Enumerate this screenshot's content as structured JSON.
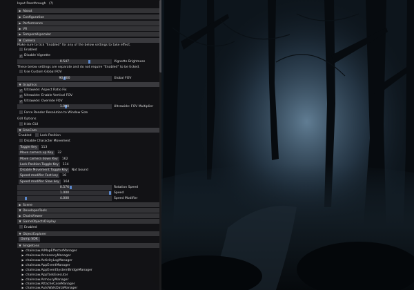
{
  "rows": {
    "input_passthrough": "Input Passthrough",
    "input_passthrough_hint": "(?)",
    "about": "About",
    "configuration": "Configuration",
    "performance": "Performance",
    "vr": "VR",
    "temporal_upscaler": "TemporalUpscaler",
    "camera": "Camera",
    "camera_note": "Make sure to tick \"Enabled\" for any of the below settings to take effect.",
    "enabled": "Enabled",
    "disable_vignette": "Disable Vignette",
    "vignette_value": "0.547",
    "vignette_label": "Vignette Brightness",
    "separate_note": "These below settings are separate and do not require \"Enabled\" to be ticked.",
    "use_custom_fov": "Use Custom Global FOV",
    "global_fov_value": "90.000",
    "global_fov_label": "Global FOV",
    "graphics": "Graphics",
    "uw_aspect": "Ultrawide: Aspect Ratio Fix",
    "uw_vfov": "Ultrawide: Enable Vertical FOV",
    "uw_override": "Ultrawide: Override FOV",
    "fov_mult_value": "1.000",
    "fov_mult_label": "Ultrawide: FOV Multiplier",
    "force_render": "Force Render Resolution to Window Size",
    "gui_options": "GUI Options",
    "hide_gui": "Hide GUI",
    "freecam": "FreeCam",
    "fc_enabled": "Enabled",
    "lock_position": "Lock Position",
    "disable_char_move": "Disable Character Movement",
    "toggle_key": "Toggle Key",
    "toggle_key_val": "113",
    "move_up_key": "Move camera up Key",
    "move_up_val": "32",
    "move_down_key": "Move camera down Key",
    "move_down_val": "162",
    "lock_toggle_key": "Lock Position Toggle Key",
    "lock_toggle_val": "114",
    "disable_move_key": "Disable Movement Toggle Key",
    "disable_move_val": "Not bound",
    "speed_fast_key": "Speed modifier Fast key",
    "speed_fast_val": "16",
    "speed_slow_key": "Speed modifier Slow key",
    "speed_slow_val": "164",
    "rot_speed_value": "0.576",
    "rot_speed_label": "Rotation Speed",
    "speed_value": "1.000",
    "speed_label": "Speed",
    "speed_mod_value": "4.000",
    "speed_mod_label": "Speed Modifier",
    "scene": "Scene",
    "developer_tools": "DeveloperTools",
    "chain_viewer": "ChainViewer",
    "game_objects_display": "GameObjectsDisplay",
    "god_enabled": "Enabled",
    "object_explorer": "ObjectExplorer",
    "dump_sdk": "Dump SDK",
    "singletons": "Singletons",
    "s1": "chainsaw.AIMapEffectorManager",
    "s2": "chainsaw.AccessoryManager",
    "s3": "chainsaw.ActivityLogManager",
    "s4": "chainsaw.AppEventManager",
    "s5": "chainsaw.AppEventSystemBridgeManager",
    "s6": "chainsaw.AppTaskExecutor",
    "s7": "chainsaw.ArmouryManager",
    "s8": "chainsaw.AttacheCaseManager",
    "s9": "chainsaw.AutoWalkDataManager"
  },
  "sliders": {
    "vignette": 0.547,
    "global_fov": 0.5,
    "fov_mult": 0.45,
    "rot_speed": 0.55,
    "speed": 0.98,
    "speed_mod": 0.08
  },
  "colors": {
    "panel_bg": "#131315",
    "header_bg": "#333336",
    "accent": "#5a86c9"
  }
}
